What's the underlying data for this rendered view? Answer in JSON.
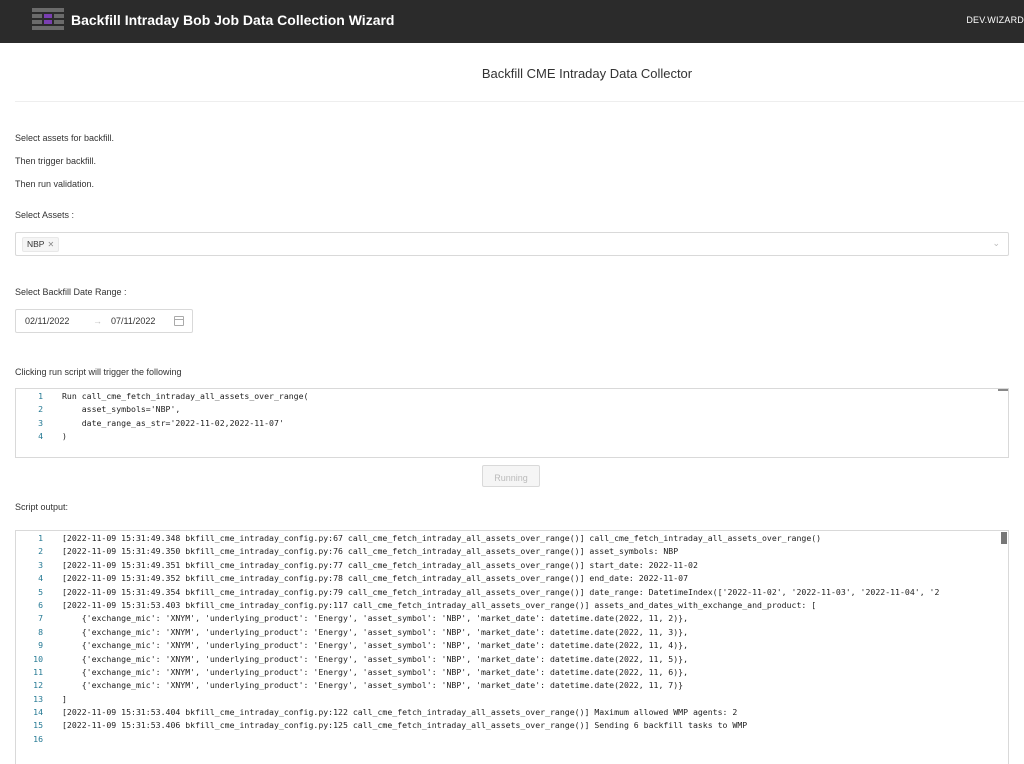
{
  "header": {
    "title": "Backfill Intraday Bob Job Data Collection Wizard",
    "env": "DEV.WIZARD",
    "logo_colors": [
      "#7a3fb1",
      "#6b6b6b"
    ]
  },
  "page": {
    "title": "Backfill CME Intraday Data Collector",
    "instructions": [
      "Select assets for backfill.",
      "Then trigger backfill.",
      "Then run validation."
    ],
    "assets_label": "Select Assets :",
    "selected_assets": [
      "NBP"
    ],
    "date_range_label": "Select Backfill Date Range :",
    "date_start": "02/11/2022",
    "date_separator": "→",
    "date_end": "07/11/2022",
    "script_intro": "Clicking run script will trigger the following",
    "run_button_label": "Running",
    "output_label": "Script output:"
  },
  "script_preview": [
    {
      "n": "1",
      "code": "Run call_cme_fetch_intraday_all_assets_over_range("
    },
    {
      "n": "2",
      "code": "    asset_symbols='NBP',"
    },
    {
      "n": "3",
      "code": "    date_range_as_str='2022-11-02,2022-11-07'"
    },
    {
      "n": "4",
      "code": ")"
    }
  ],
  "script_output": [
    {
      "n": "1",
      "code": "[2022-11-09 15:31:49.348 bkfill_cme_intraday_config.py:67 call_cme_fetch_intraday_all_assets_over_range()] call_cme_fetch_intraday_all_assets_over_range()"
    },
    {
      "n": "2",
      "code": "[2022-11-09 15:31:49.350 bkfill_cme_intraday_config.py:76 call_cme_fetch_intraday_all_assets_over_range()] asset_symbols: NBP"
    },
    {
      "n": "3",
      "code": "[2022-11-09 15:31:49.351 bkfill_cme_intraday_config.py:77 call_cme_fetch_intraday_all_assets_over_range()] start_date: 2022-11-02"
    },
    {
      "n": "4",
      "code": "[2022-11-09 15:31:49.352 bkfill_cme_intraday_config.py:78 call_cme_fetch_intraday_all_assets_over_range()] end_date: 2022-11-07"
    },
    {
      "n": "5",
      "code": "[2022-11-09 15:31:49.354 bkfill_cme_intraday_config.py:79 call_cme_fetch_intraday_all_assets_over_range()] date_range: DatetimeIndex(['2022-11-02', '2022-11-03', '2022-11-04', '2"
    },
    {
      "n": "6",
      "code": "[2022-11-09 15:31:53.403 bkfill_cme_intraday_config.py:117 call_cme_fetch_intraday_all_assets_over_range()] assets_and_dates_with_exchange_and_product: ["
    },
    {
      "n": "7",
      "code": "    {'exchange_mic': 'XNYM', 'underlying_product': 'Energy', 'asset_symbol': 'NBP', 'market_date': datetime.date(2022, 11, 2)},"
    },
    {
      "n": "8",
      "code": "    {'exchange_mic': 'XNYM', 'underlying_product': 'Energy', 'asset_symbol': 'NBP', 'market_date': datetime.date(2022, 11, 3)},"
    },
    {
      "n": "9",
      "code": "    {'exchange_mic': 'XNYM', 'underlying_product': 'Energy', 'asset_symbol': 'NBP', 'market_date': datetime.date(2022, 11, 4)},"
    },
    {
      "n": "10",
      "code": "    {'exchange_mic': 'XNYM', 'underlying_product': 'Energy', 'asset_symbol': 'NBP', 'market_date': datetime.date(2022, 11, 5)},"
    },
    {
      "n": "11",
      "code": "    {'exchange_mic': 'XNYM', 'underlying_product': 'Energy', 'asset_symbol': 'NBP', 'market_date': datetime.date(2022, 11, 6)},"
    },
    {
      "n": "12",
      "code": "    {'exchange_mic': 'XNYM', 'underlying_product': 'Energy', 'asset_symbol': 'NBP', 'market_date': datetime.date(2022, 11, 7)}"
    },
    {
      "n": "13",
      "code": "]"
    },
    {
      "n": "14",
      "code": "[2022-11-09 15:31:53.404 bkfill_cme_intraday_config.py:122 call_cme_fetch_intraday_all_assets_over_range()] Maximum allowed WMP agents: 2"
    },
    {
      "n": "15",
      "code": "[2022-11-09 15:31:53.406 bkfill_cme_intraday_config.py:125 call_cme_fetch_intraday_all_assets_over_range()] Sending 6 backfill tasks to WMP"
    },
    {
      "n": "16",
      "code": ""
    }
  ]
}
